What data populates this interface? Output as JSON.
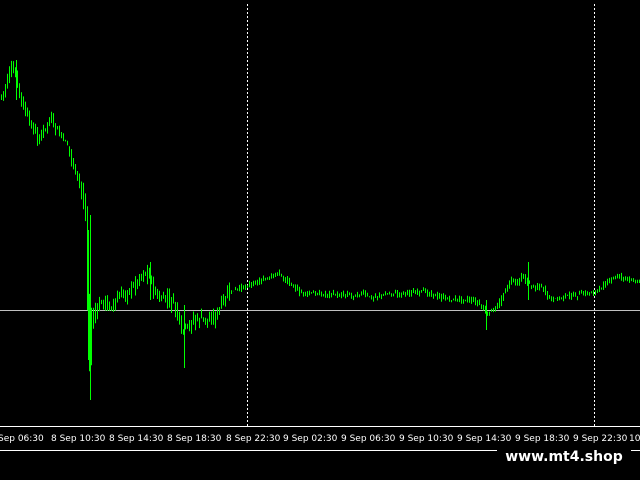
{
  "chart": {
    "type": "candlestick",
    "colors": {
      "background": "#000000",
      "candle": "#00ff00",
      "grid_separator": "#ffffff",
      "horizontal_line": "#c0c0c0",
      "axis_text": "#ffffff"
    },
    "time_labels": [
      "Sep 06:30",
      "8 Sep 10:30",
      "8 Sep 14:30",
      "8 Sep 18:30",
      "8 Sep 22:30",
      "9 Sep 02:30",
      "9 Sep 06:30",
      "9 Sep 10:30",
      "9 Sep 14:30",
      "9 Sep 18:30",
      "9 Sep 22:30",
      "10"
    ],
    "day_separators_after_label": [
      "8 Sep 22:30",
      "9 Sep 22:30"
    ]
  },
  "watermark": {
    "text": "www.mt4.shop"
  }
}
